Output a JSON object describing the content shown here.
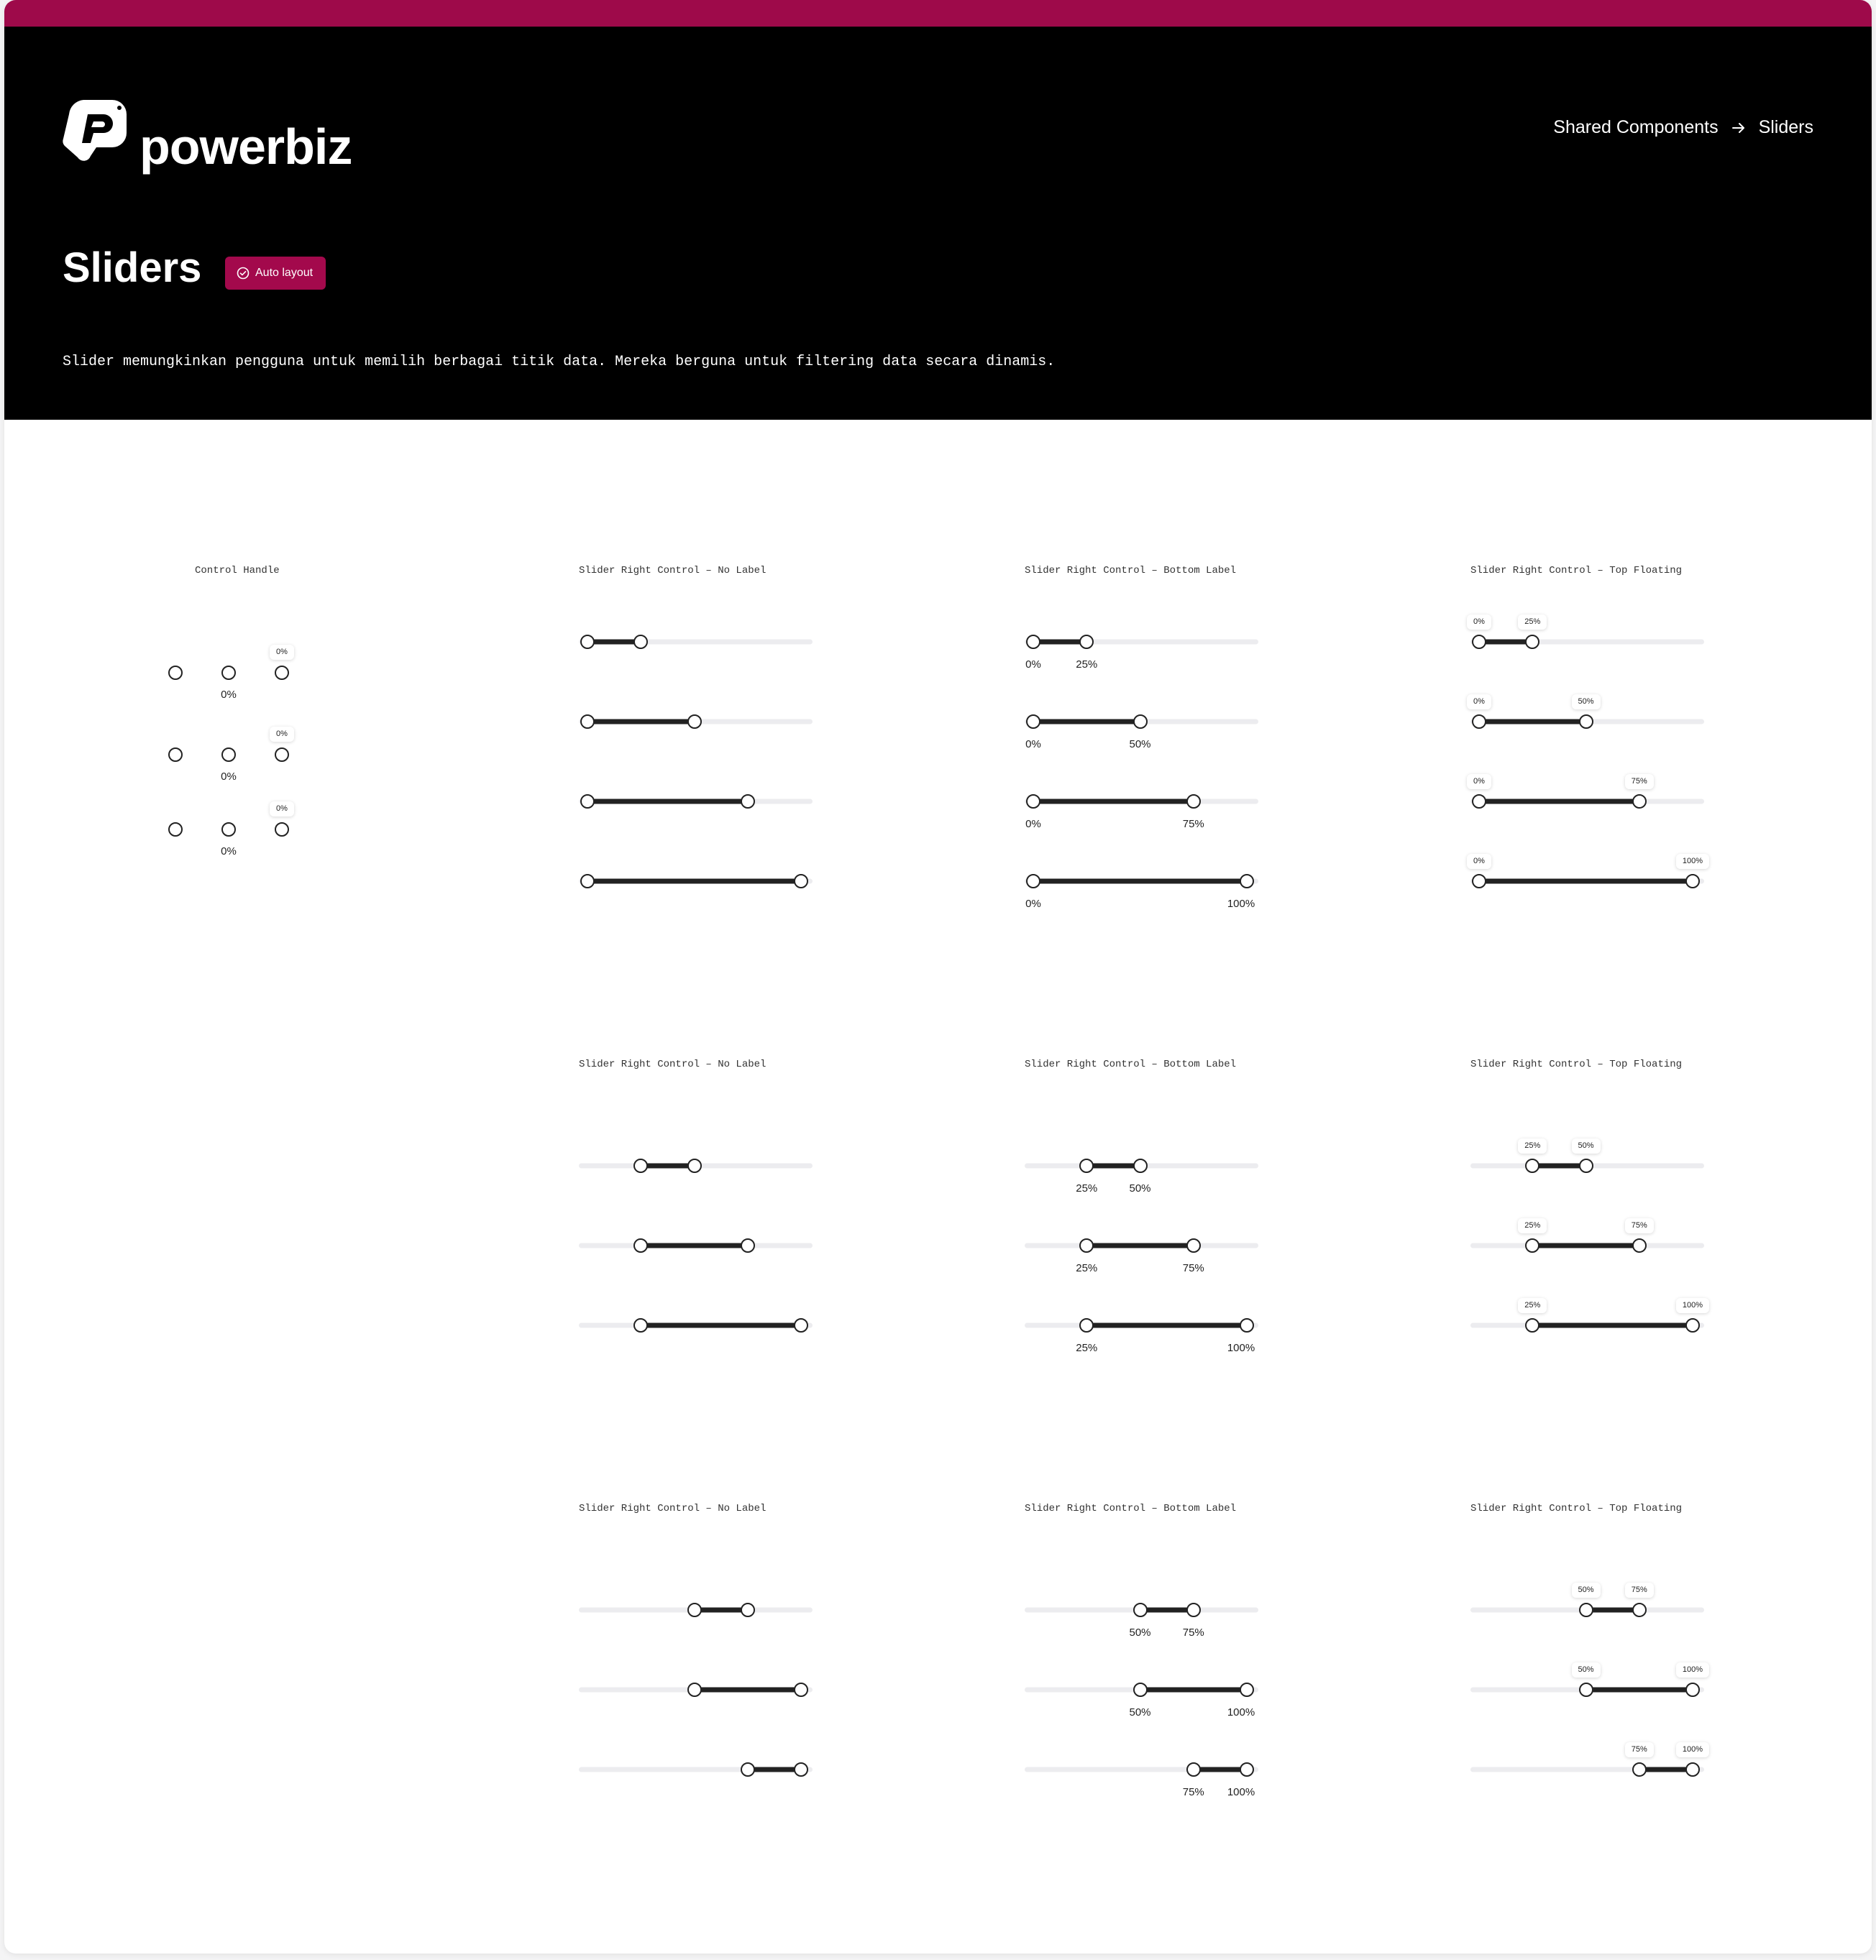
{
  "brand": {
    "name": "powerbiz",
    "accent_color": "#9e0a4a",
    "logo_icon": "powerbiz-logo-icon"
  },
  "breadcrumb": {
    "parent": "Shared Components",
    "separator_icon": "arrow-right-icon",
    "current": "Sliders"
  },
  "page": {
    "title": "Sliders",
    "badge": {
      "label": "Auto layout",
      "icon": "check-circle-icon"
    },
    "description": "Slider memungkinkan pengguna untuk memilih berbagai titik data. Mereka berguna untuk filtering data secara dinamis."
  },
  "control_handle": {
    "title": "Control Handle",
    "rows": [
      {
        "bottom_label": "0%",
        "floating_label": "0%"
      },
      {
        "bottom_label": "0%",
        "floating_label": "0%"
      },
      {
        "bottom_label": "0%",
        "floating_label": "0%"
      }
    ]
  },
  "groups": [
    {
      "columns": [
        {
          "variant": "none",
          "title": "Slider Right Control – No Label"
        },
        {
          "variant": "bottom",
          "title": "Slider Right Control – Bottom Label"
        },
        {
          "variant": "top",
          "title": "Slider Right Control – Top Floating"
        }
      ],
      "sliders": [
        {
          "start": 0,
          "end": 25,
          "start_label": "0%",
          "end_label": "25%"
        },
        {
          "start": 0,
          "end": 50,
          "start_label": "0%",
          "end_label": "50%"
        },
        {
          "start": 0,
          "end": 75,
          "start_label": "0%",
          "end_label": "75%"
        },
        {
          "start": 0,
          "end": 100,
          "start_label": "0%",
          "end_label": "100%"
        }
      ]
    },
    {
      "columns": [
        {
          "variant": "none",
          "title": "Slider Right Control – No Label"
        },
        {
          "variant": "bottom",
          "title": "Slider Right Control – Bottom Label"
        },
        {
          "variant": "top",
          "title": "Slider Right Control – Top Floating"
        }
      ],
      "sliders": [
        {
          "start": 25,
          "end": 50,
          "start_label": "25%",
          "end_label": "50%"
        },
        {
          "start": 25,
          "end": 75,
          "start_label": "25%",
          "end_label": "75%"
        },
        {
          "start": 25,
          "end": 100,
          "start_label": "25%",
          "end_label": "100%"
        }
      ]
    },
    {
      "columns": [
        {
          "variant": "none",
          "title": "Slider Right Control – No Label"
        },
        {
          "variant": "bottom",
          "title": "Slider Right Control – Bottom Label"
        },
        {
          "variant": "top",
          "title": "Slider Right Control – Top Floating"
        }
      ],
      "sliders": [
        {
          "start": 50,
          "end": 75,
          "start_label": "50%",
          "end_label": "75%"
        },
        {
          "start": 50,
          "end": 100,
          "start_label": "50%",
          "end_label": "100%"
        },
        {
          "start": 75,
          "end": 100,
          "start_label": "75%",
          "end_label": "100%"
        }
      ]
    }
  ]
}
